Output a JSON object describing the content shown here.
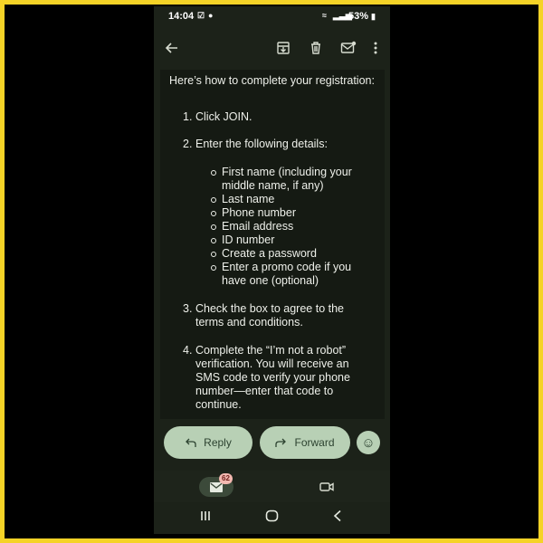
{
  "status": {
    "time": "14:04",
    "battery": "53%"
  },
  "email": {
    "intro": "Here’s how to complete your registration:",
    "steps": [
      {
        "num": "1.",
        "text": "Click JOIN."
      },
      {
        "num": "2.",
        "text": "Enter the following details:"
      },
      {
        "num": "3.",
        "text": "Check the box to agree to the terms and conditions."
      },
      {
        "num": "4.",
        "text": "Complete the “I’m not a robot” verification. You will receive an SMS code to verify your phone number—enter that code to continue."
      }
    ],
    "details": [
      "First name (including your middle name, if any)",
      "Last name",
      "Phone number",
      "Email address",
      "ID number",
      "Create a password",
      "Enter a promo code if you have one (optional)"
    ]
  },
  "actions": {
    "reply_label": "Reply",
    "forward_label": "Forward"
  },
  "nav": {
    "mail_badge": "62"
  },
  "colors": {
    "frame": "#f5d327",
    "pill": "#b8d0b5",
    "background": "#1c2219"
  }
}
